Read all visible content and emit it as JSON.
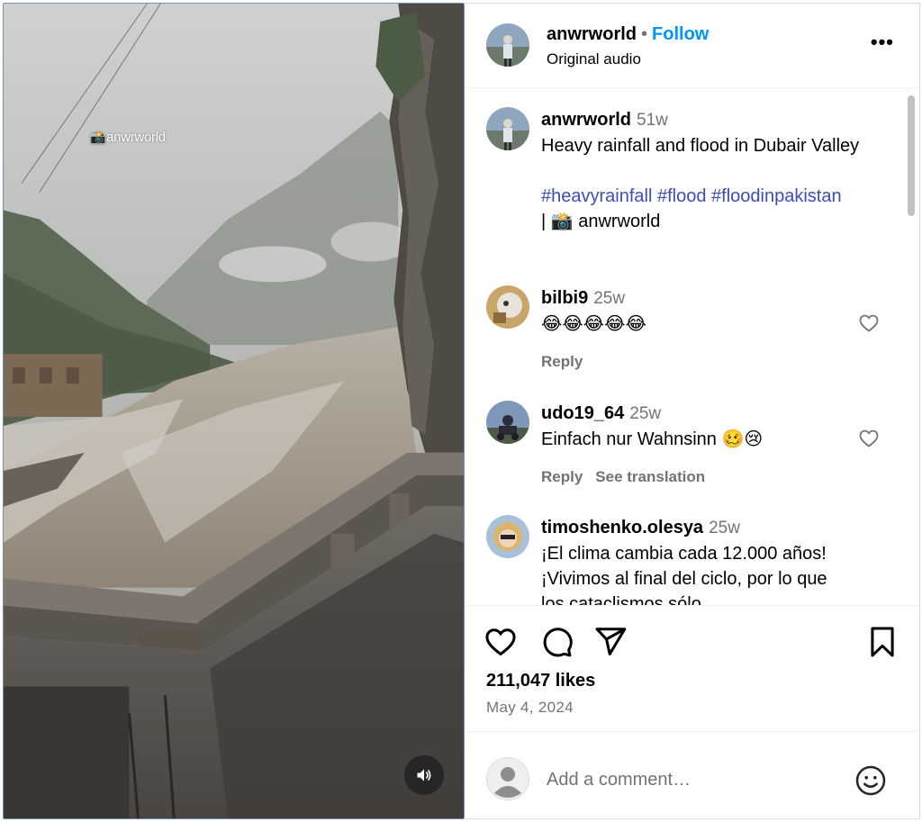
{
  "media": {
    "watermark_text": "anwrworld",
    "sound_icon": "speaker-icon"
  },
  "header": {
    "username": "anwrworld",
    "separator": "•",
    "follow_label": "Follow",
    "audio_label": "Original audio",
    "more_label": "•••"
  },
  "caption": {
    "username": "anwrworld",
    "time": "51w",
    "text": "Heavy rainfall and flood in Dubair Valley",
    "hashtags": "#heavyrainfall #flood #floodinpakistan",
    "credit": "| 📸 anwrworld"
  },
  "comments": [
    {
      "username": "bilbi9",
      "time": "25w",
      "text": "😂😂😂😂😂",
      "reply_label": "Reply"
    },
    {
      "username": "udo19_64",
      "time": "25w",
      "text": "Einfach nur Wahnsinn 🥴😢",
      "reply_label": "Reply",
      "translate_label": "See translation"
    },
    {
      "username": "timoshenko.olesya",
      "time": "25w",
      "text": "¡El clima cambia cada 12.000 años! ¡Vivimos al final del ciclo, por lo que los cataclismos sólo"
    }
  ],
  "actions": {
    "likes": "211,047 likes",
    "date": "May 4, 2024",
    "icons": [
      "heart-icon",
      "comment-icon",
      "share-icon",
      "bookmark-icon"
    ]
  },
  "add_comment": {
    "placeholder": "Add a comment…"
  },
  "colors": {
    "follow": "#0095f6",
    "hashtag": "#3a4db8",
    "secondary_text": "#737373"
  }
}
